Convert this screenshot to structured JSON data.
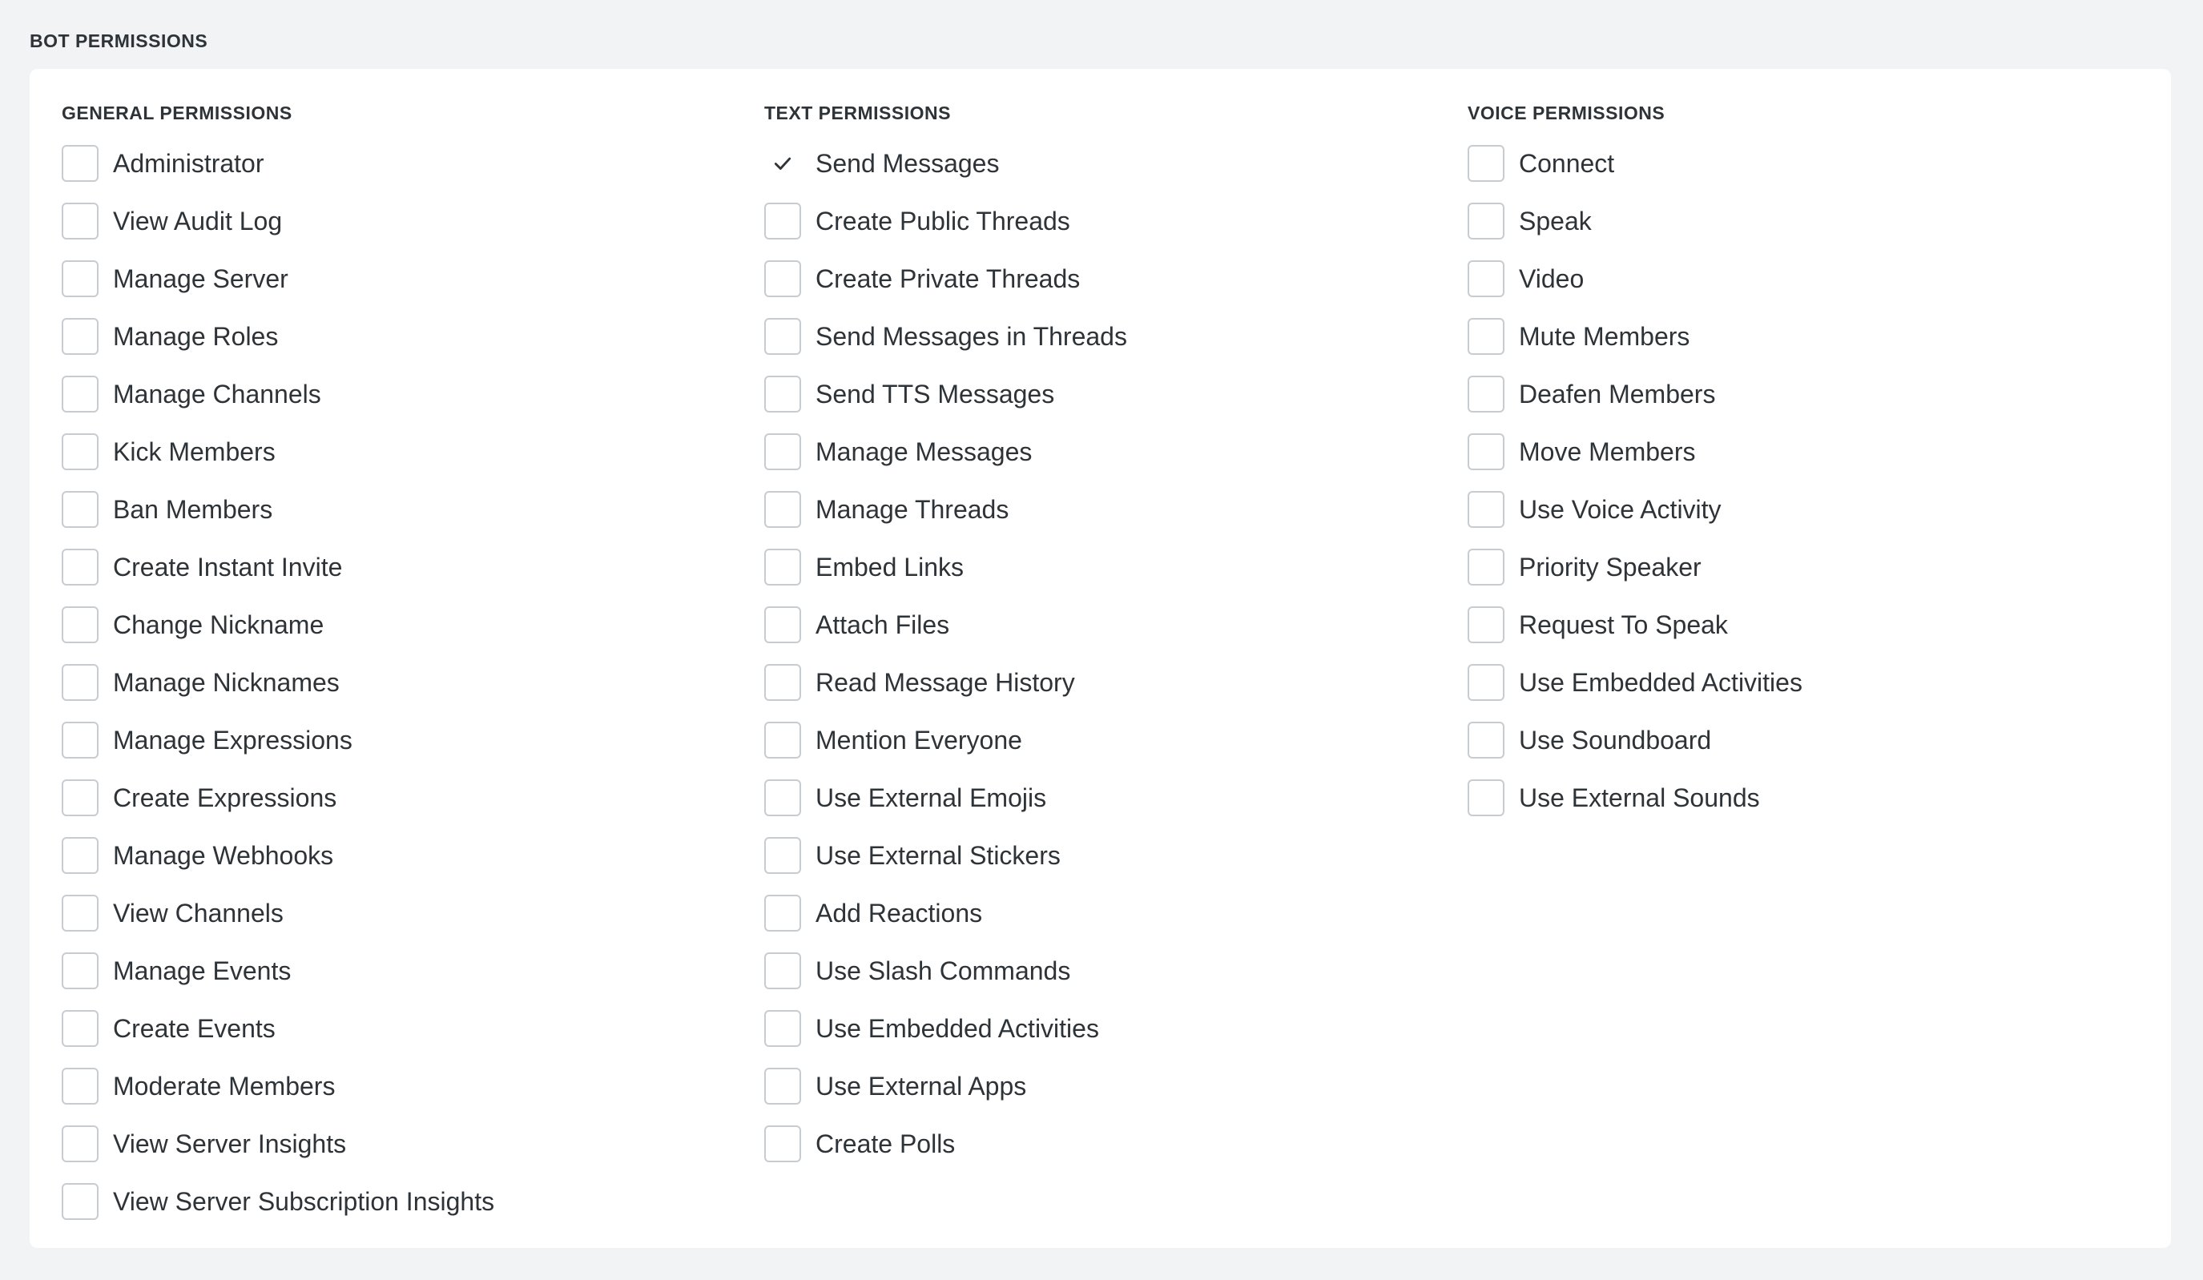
{
  "section_title": "BOT PERMISSIONS",
  "columns": {
    "general": {
      "title": "GENERAL PERMISSIONS",
      "items": [
        {
          "label": "Administrator",
          "checked": false
        },
        {
          "label": "View Audit Log",
          "checked": false
        },
        {
          "label": "Manage Server",
          "checked": false
        },
        {
          "label": "Manage Roles",
          "checked": false
        },
        {
          "label": "Manage Channels",
          "checked": false
        },
        {
          "label": "Kick Members",
          "checked": false
        },
        {
          "label": "Ban Members",
          "checked": false
        },
        {
          "label": "Create Instant Invite",
          "checked": false
        },
        {
          "label": "Change Nickname",
          "checked": false
        },
        {
          "label": "Manage Nicknames",
          "checked": false
        },
        {
          "label": "Manage Expressions",
          "checked": false
        },
        {
          "label": "Create Expressions",
          "checked": false
        },
        {
          "label": "Manage Webhooks",
          "checked": false
        },
        {
          "label": "View Channels",
          "checked": false
        },
        {
          "label": "Manage Events",
          "checked": false
        },
        {
          "label": "Create Events",
          "checked": false
        },
        {
          "label": "Moderate Members",
          "checked": false
        },
        {
          "label": "View Server Insights",
          "checked": false
        },
        {
          "label": "View Server Subscription Insights",
          "checked": false
        }
      ]
    },
    "text": {
      "title": "TEXT PERMISSIONS",
      "items": [
        {
          "label": "Send Messages",
          "checked": true
        },
        {
          "label": "Create Public Threads",
          "checked": false
        },
        {
          "label": "Create Private Threads",
          "checked": false
        },
        {
          "label": "Send Messages in Threads",
          "checked": false
        },
        {
          "label": "Send TTS Messages",
          "checked": false
        },
        {
          "label": "Manage Messages",
          "checked": false
        },
        {
          "label": "Manage Threads",
          "checked": false
        },
        {
          "label": "Embed Links",
          "checked": false
        },
        {
          "label": "Attach Files",
          "checked": false
        },
        {
          "label": "Read Message History",
          "checked": false
        },
        {
          "label": "Mention Everyone",
          "checked": false
        },
        {
          "label": "Use External Emojis",
          "checked": false
        },
        {
          "label": "Use External Stickers",
          "checked": false
        },
        {
          "label": "Add Reactions",
          "checked": false
        },
        {
          "label": "Use Slash Commands",
          "checked": false
        },
        {
          "label": "Use Embedded Activities",
          "checked": false
        },
        {
          "label": "Use External Apps",
          "checked": false
        },
        {
          "label": "Create Polls",
          "checked": false
        }
      ]
    },
    "voice": {
      "title": "VOICE PERMISSIONS",
      "items": [
        {
          "label": "Connect",
          "checked": false
        },
        {
          "label": "Speak",
          "checked": false
        },
        {
          "label": "Video",
          "checked": false
        },
        {
          "label": "Mute Members",
          "checked": false
        },
        {
          "label": "Deafen Members",
          "checked": false
        },
        {
          "label": "Move Members",
          "checked": false
        },
        {
          "label": "Use Voice Activity",
          "checked": false
        },
        {
          "label": "Priority Speaker",
          "checked": false
        },
        {
          "label": "Request To Speak",
          "checked": false
        },
        {
          "label": "Use Embedded Activities",
          "checked": false
        },
        {
          "label": "Use Soundboard",
          "checked": false
        },
        {
          "label": "Use External Sounds",
          "checked": false
        }
      ]
    }
  },
  "colors": {
    "page_background": "#f2f3f5",
    "panel_background": "#ffffff",
    "text": "#2e3338",
    "checkbox_border": "#c7ccd1",
    "checkmark": "#2e3338"
  },
  "icons": {
    "check": "check-icon"
  }
}
